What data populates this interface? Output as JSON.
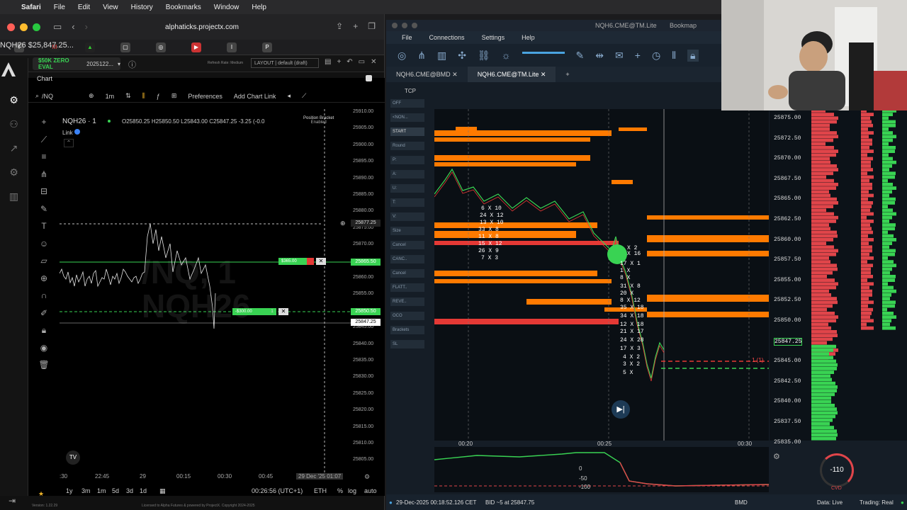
{
  "menubar": {
    "app": "Safari",
    "items": [
      "File",
      "Edit",
      "View",
      "History",
      "Bookmarks",
      "Window",
      "Help"
    ]
  },
  "safari": {
    "url": "alphaticks.projectx.com",
    "active_tab": "NQH26 $25,847.25..."
  },
  "app": {
    "account": "$50K ZERO EVAL",
    "account_id": "2025122...",
    "layout": "LAYOUT | default (draft)",
    "refresh": "Refresh Rate: Medium",
    "panel_title": "Chart",
    "search_value": "/NQ",
    "timeframe": "1m",
    "preferences": "Preferences",
    "add_chart_link": "Add Chart Link",
    "symbol": "NQH26 · 1",
    "ohlc": "O25850.25 H25850.50 L25843.00 C25847.25 -3.25 (-0.0",
    "link": "Link",
    "position_bracket": "Position Bracket",
    "position_bracket_state": "Enabled",
    "watermark_line1": "/NQ, 1",
    "watermark_line2": "NQH26",
    "price_ticks": [
      "25910.00",
      "25905.00",
      "25900.00",
      "25895.00",
      "25890.00",
      "25885.00",
      "25880.00",
      "25875.00",
      "25870.00",
      "25865.00",
      "25860.00",
      "25855.00",
      "25850.00",
      "25845.00",
      "25840.00",
      "25835.00",
      "25830.00",
      "25825.00",
      "25820.00",
      "25815.00",
      "25810.00",
      "25805.00"
    ],
    "cursor_price": "25877.25",
    "tp_price": "25865.50",
    "sl_price": "25850.50",
    "last_price": "25847.25",
    "tp_order": "$365.00",
    "sl_order": "-$300.00",
    "sl_qty": "1",
    "time_labels": [
      ":30",
      "22:45",
      "29",
      "00:15",
      "00:30",
      "00:45",
      "29 Dec '25  01:07"
    ],
    "ranges": [
      "1y",
      "3m",
      "1m",
      "5d",
      "3d",
      "1d"
    ],
    "clock": "00:26:56 (UTC+1)",
    "session": "ETH",
    "pct": "%",
    "log": "log",
    "auto": "auto",
    "version": "Version: 1.22.29",
    "footer": "Licensed to Alpha Futures & powered by ProjectX. Copyright 2024-2025"
  },
  "bookmap": {
    "title": "NQH6.CME@TM.Lite",
    "app_name": "Bookmap",
    "menu": [
      "File",
      "Connections",
      "Settings",
      "Help"
    ],
    "tabs": [
      "NQH6.CME@BMD",
      "NQH6.CME@TM.Lite"
    ],
    "tcp": "TCP",
    "side_buttons": [
      "OFF",
      "<NON...",
      "START",
      "Round",
      "P:",
      "A:",
      "U:",
      "T:",
      "V:",
      "Size",
      "Cancel",
      "CANC..",
      "Cancel",
      "FLATT..",
      "REVE..",
      "OCO",
      "Brackets",
      "SL"
    ],
    "prices": [
      "25875.00",
      "25872.50",
      "25870.00",
      "25867.50",
      "25865.00",
      "25862.50",
      "25860.00",
      "25857.50",
      "25855.00",
      "25852.50",
      "25850.00",
      "25847.25",
      "25845.00",
      "25842.50",
      "25840.00",
      "25837.50",
      "25835.00"
    ],
    "time_labels": [
      "00:20",
      "00:25",
      "00:30"
    ],
    "trade_labels": [
      "6 X 10",
      "24 X 12",
      "13 X 10",
      "33 X 8",
      "11 X 8",
      "15 X 12",
      "26 X 9",
      "7 X 3",
      "X 2",
      "X 16",
      "17 X 1",
      "1 X",
      "8 X",
      "31 X 8",
      "20 X",
      "8 X 12",
      "35 X 18",
      "34 X 18",
      "12 X 18",
      "21 X 17",
      "24 X 28",
      "17 X 3",
      "4 X 2",
      "3 X 2",
      "5 X"
    ],
    "position_marker": "1 (1)",
    "cvd_labels": [
      "0",
      "-50",
      "-100"
    ],
    "cvd_value": "-110",
    "cvd_name": "CVD",
    "status_time": "29-Dec-2025 00:18:52.126 CET",
    "status_bid": "BID ~5 at 25847.75",
    "status_src": "BMD",
    "data_live": "Data: Live",
    "trading_real": "Trading: Real"
  },
  "colors": {
    "green": "#39d353",
    "red": "#e53935",
    "orange": "#ff7a00",
    "bm_red": "#e0454a"
  }
}
